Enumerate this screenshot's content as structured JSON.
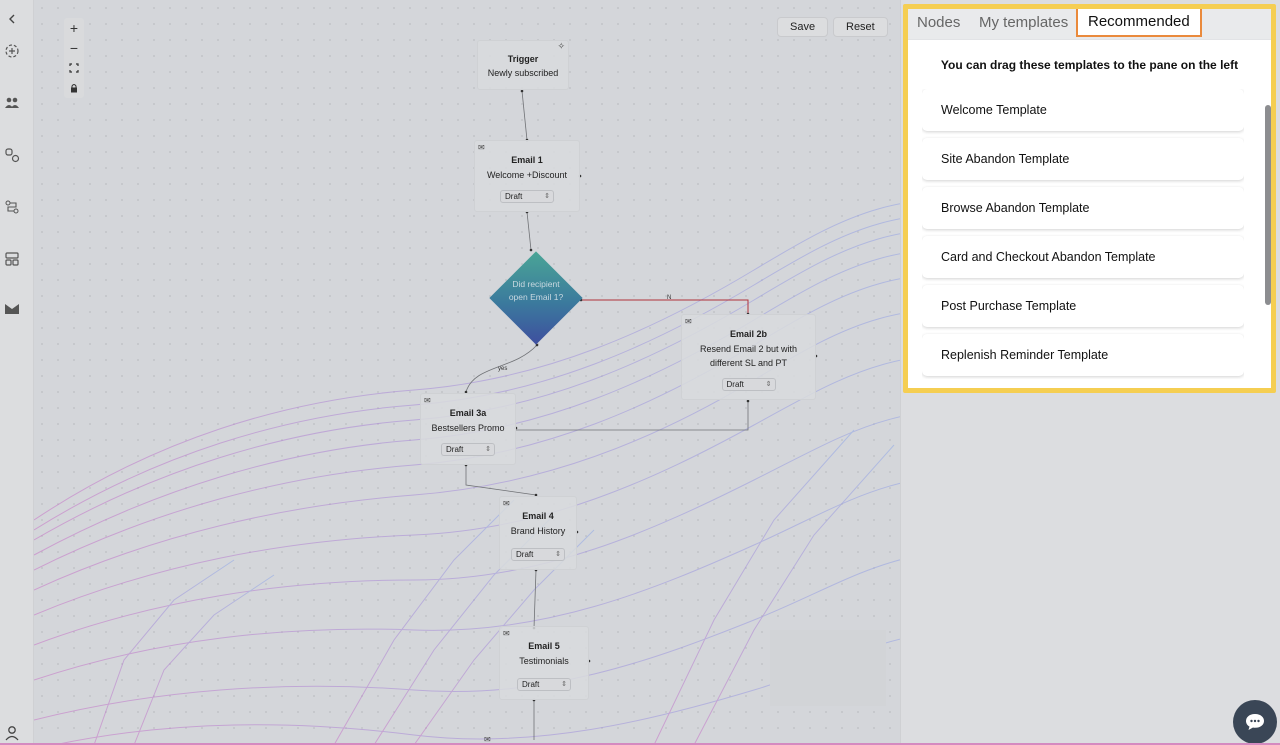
{
  "toolbar": {
    "save_label": "Save",
    "reset_label": "Reset"
  },
  "zoom_controls": {
    "zoom_in": "+",
    "zoom_out": "−",
    "fit": "⛶",
    "lock": "🔒"
  },
  "nodes": {
    "trigger": {
      "title": "Trigger",
      "desc": "Newly subscribed"
    },
    "email1": {
      "title": "Email 1",
      "desc": "Welcome +Discount",
      "status": "Draft"
    },
    "decision": {
      "text": "Did recipient open Email 1?",
      "no_label": "N",
      "yes_label": "yes"
    },
    "email2b": {
      "title": "Email 2b",
      "desc": "Resend Email 2 but with different SL and PT",
      "status": "Draft"
    },
    "email3a": {
      "title": "Email 3a",
      "desc": "Bestsellers Promo",
      "status": "Draft"
    },
    "email4": {
      "title": "Email 4",
      "desc": "Brand History",
      "status": "Draft"
    },
    "email5": {
      "title": "Email 5",
      "desc": "Testimonials",
      "status": "Draft"
    }
  },
  "panel": {
    "tabs": [
      {
        "label": "Nodes",
        "active": false
      },
      {
        "label": "My templates",
        "active": false
      },
      {
        "label": "Recommended",
        "active": true
      }
    ],
    "heading": "You can drag these templates to the pane on the left",
    "templates": [
      "Welcome Template",
      "Site Abandon Template",
      "Browse Abandon Template",
      "Card and Checkout Abandon Template",
      "Post Purchase Template",
      "Replenish Reminder Template"
    ]
  },
  "sidebar": {
    "icons": [
      "chevron-left-icon",
      "add-circle-icon",
      "users-icon",
      "nodes-icon",
      "flow-icon",
      "layout-icon",
      "mail-icon",
      "user-icon"
    ]
  },
  "colors": {
    "highlight": "#f5ce52",
    "active_tab_border": "#ea8a3c",
    "decision_fill": "#3b7a9d",
    "chat_button": "#3a4656"
  }
}
